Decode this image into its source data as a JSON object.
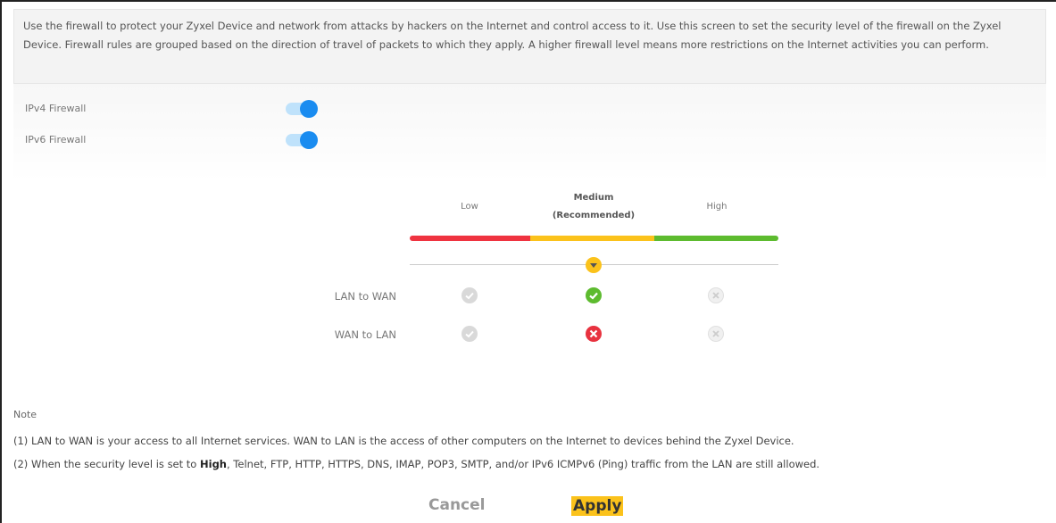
{
  "description": "Use the firewall to protect your Zyxel Device and network from attacks by hackers on the Internet and control access to it. Use this screen to set the security level of the firewall on the Zyxel Device. Firewall rules are grouped based on the direction of travel of packets to which they apply. A higher firewall level means more restrictions on the Internet activities you can perform.",
  "toggles": [
    {
      "label": "IPv4 Firewall",
      "state": "on"
    },
    {
      "label": "IPv6 Firewall",
      "state": "on"
    }
  ],
  "levels": {
    "low": "Low",
    "medium_line1": "Medium",
    "medium_line2": "(Recommended)",
    "high": "High",
    "selected": "Medium"
  },
  "rows": [
    {
      "label": "LAN to WAN",
      "low": "allow-dim",
      "medium": "allow",
      "high": "block-dim"
    },
    {
      "label": "WAN to LAN",
      "low": "allow-dim",
      "medium": "block",
      "high": "block-dim"
    }
  ],
  "colors": {
    "accent_blue": "#1a8cf0",
    "red": "#ef3340",
    "yellow": "#fbc21b",
    "green": "#5dbb2f"
  },
  "note": {
    "title": "Note",
    "line1": "(1) LAN to WAN is your access to all Internet services. WAN to LAN is the access of other computers on the Internet to devices behind the Zyxel Device.",
    "line2_pre": "(2) When the security level is set to ",
    "line2_bold": "High",
    "line2_post": ", Telnet, FTP, HTTP, HTTPS, DNS, IMAP, POP3, SMTP, and/or IPv6 ICMPv6 (Ping) traffic from the LAN are still allowed."
  },
  "buttons": {
    "cancel": "Cancel",
    "apply": "Apply"
  }
}
